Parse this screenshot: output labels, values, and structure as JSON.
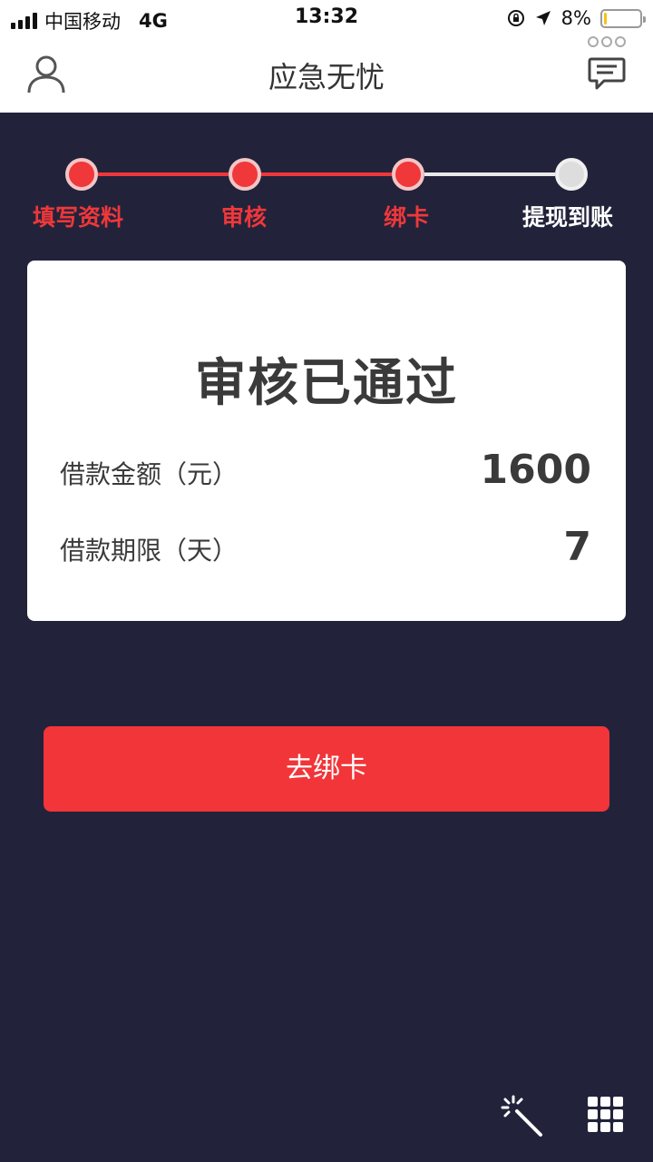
{
  "status_bar": {
    "carrier": "中国移动",
    "network": "4G",
    "time": "13:32",
    "battery": "8%",
    "battery_level": 0.08
  },
  "header": {
    "title": "应急无忧",
    "left_icon": "user-icon",
    "right_icon": "message-icon"
  },
  "steps": [
    {
      "label": "填写资料",
      "active": true
    },
    {
      "label": "审核",
      "active": true
    },
    {
      "label": "绑卡",
      "active": true
    },
    {
      "label": "提现到账",
      "active": false
    }
  ],
  "card": {
    "title": "审核已通过",
    "amount_label": "借款金额（元）",
    "amount_value": "1600",
    "term_label": "借款期限（天）",
    "term_value": "7"
  },
  "button": {
    "label": "去绑卡"
  },
  "colors": {
    "accent": "#f13539",
    "background": "#22233a",
    "inactive_step": "#dddddd"
  }
}
